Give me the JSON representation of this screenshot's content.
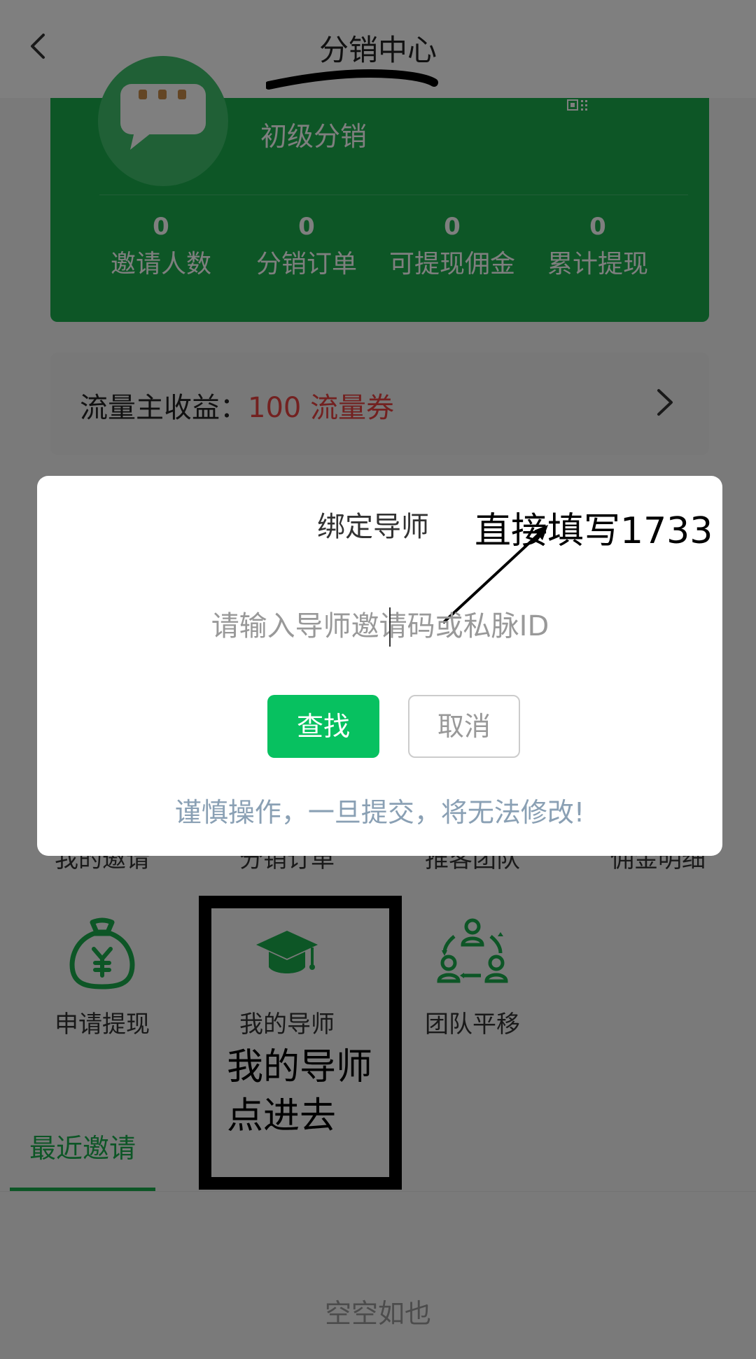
{
  "header": {
    "title": "分销中心"
  },
  "profile": {
    "level": "初级分销"
  },
  "stats": [
    {
      "value": "0",
      "label": "邀请人数"
    },
    {
      "value": "0",
      "label": "分销订单"
    },
    {
      "value": "0",
      "label": "可提现佣金"
    },
    {
      "value": "0",
      "label": "累计提现"
    }
  ],
  "traffic": {
    "label": "流量主收益：",
    "value": "100 流量券"
  },
  "grid_labels": [
    "我的邀请",
    "分销订单",
    "推客团队",
    "佣金明细"
  ],
  "features": [
    {
      "label": "申请提现",
      "icon": "money-bag-icon"
    },
    {
      "label": "我的导师",
      "icon": "graduation-cap-icon"
    },
    {
      "label": "团队平移",
      "icon": "team-transfer-icon"
    }
  ],
  "tabs": {
    "active": "最近邀请"
  },
  "empty_text": "空空如也",
  "dialog": {
    "title": "绑定导师",
    "input_placeholder": "请输入导师邀请码或私脉ID",
    "search_label": "查找",
    "cancel_label": "取消",
    "warning": "谨慎操作，一旦提交，将无法修改!"
  },
  "annotations": {
    "fill_hint": "直接填写1733",
    "mentor_hint_line1": "我的导师",
    "mentor_hint_line2": "点进去"
  },
  "colors": {
    "brand_green": "#1aad4d",
    "button_green": "#07c160",
    "accent_red": "#e64340"
  }
}
